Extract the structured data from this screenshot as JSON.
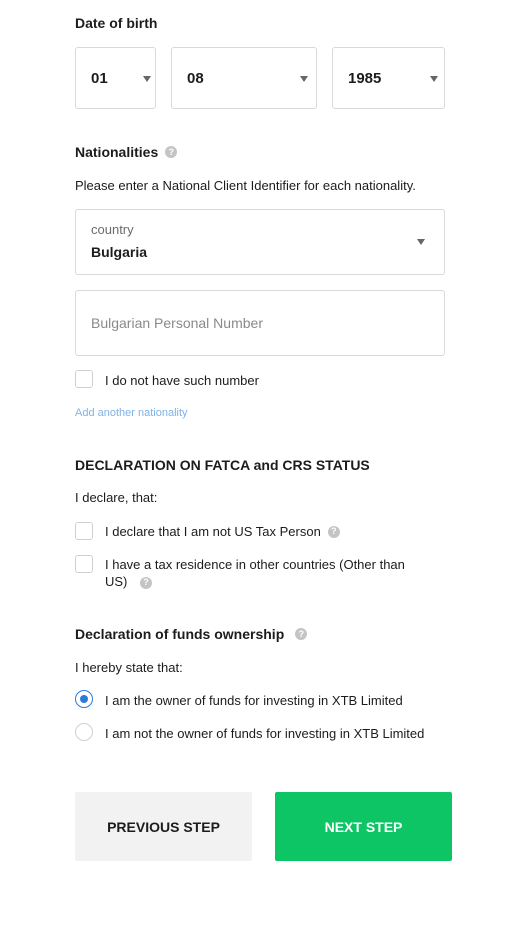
{
  "dob": {
    "label": "Date of birth",
    "day": "01",
    "month": "08",
    "year": "1985"
  },
  "nationalities": {
    "title": "Nationalities",
    "help_icon": "?",
    "instruction": "Please enter a National Client Identifier for each nationality.",
    "country_label": "country",
    "country_value": "Bulgaria",
    "id_placeholder": "Bulgarian Personal Number",
    "no_number_label": "I do not have such number",
    "add_link": "Add another nationality"
  },
  "fatca": {
    "title": "DECLARATION ON FATCA and CRS STATUS",
    "intro": "I declare, that:",
    "option1": "I declare that I am not US Tax Person",
    "option2": "I have a tax residence in other countries (Other than US)"
  },
  "funds": {
    "title": "Declaration of funds ownership",
    "intro": "I hereby state that:",
    "option_owner": "I am the owner of funds for investing in XTB Limited",
    "option_not_owner": "I am not the owner of funds for investing in XTB Limited",
    "selected": "owner"
  },
  "buttons": {
    "previous": "PREVIOUS STEP",
    "next": "NEXT STEP"
  },
  "colors": {
    "accent": "#2f7ad8",
    "next_button": "#0dc565",
    "prev_button": "#f2f2f2",
    "link": "#7fb3e6"
  }
}
